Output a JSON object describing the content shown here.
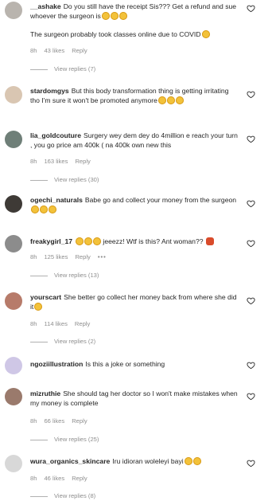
{
  "comments": [
    {
      "username": "__ashake",
      "text": "Do you still have the receipt Sis??? Get a refund and sue whoever the surgeon is",
      "emojis": [
        "grinning-sweat",
        "grinning-sweat",
        "grinning-sweat"
      ],
      "extra_text": "The surgeon probably took classes online due to COVID",
      "extra_emojis": [
        "grinning-sweat"
      ],
      "time": "8h",
      "likes": "43 likes",
      "reply": "Reply",
      "view_replies": "View replies (7)",
      "avatar_color": "#b9b4ae"
    },
    {
      "username": "stardomgys",
      "text": "But this body transformation thing is getting irritating tho I'm sure it won't be promoted anymore",
      "emojis": [
        "sad-face",
        "sad-face",
        "sad-face"
      ],
      "avatar_color": "#d9c6b2"
    },
    {
      "username": "lia_goldcouture",
      "text": "Surgery wey dem dey do 4million e reach your turn , you go price am 400k ( na 400k own new this",
      "time": "8h",
      "likes": "163 likes",
      "reply": "Reply",
      "view_replies": "View replies (30)",
      "avatar_color": "#6f7f78"
    },
    {
      "username": "ogechi_naturals",
      "text": "Babe go and collect your money from the surgeon",
      "emojis": [
        "sad-face",
        "sad-face",
        "sad-face"
      ],
      "avatar_color": "#3e3a36"
    },
    {
      "username": "freakygirl_17",
      "text": "",
      "emojis": [
        "grinning-sweat",
        "grinning-sweat",
        "grinning-sweat"
      ],
      "after_text": "jeeezz! Wtf is this? Ant woman??",
      "after_emojis": [
        "ant"
      ],
      "time": "8h",
      "likes": "125 likes",
      "reply": "Reply",
      "more": "•••",
      "view_replies": "View replies (13)",
      "avatar_color": "#8c8c8c"
    },
    {
      "username": "yourscart",
      "text": "She better go collect her money back from where she did it",
      "emojis": [
        "sad-face"
      ],
      "time": "8h",
      "likes": "114 likes",
      "reply": "Reply",
      "view_replies": "View replies (2)",
      "avatar_color": "#b77b6a"
    },
    {
      "username": "ngoziillustration",
      "text": "Is this a joke or something",
      "avatar_color": "#cfc7e6"
    },
    {
      "username": "mizruthie",
      "text": "She should tag her doctor so I won't make mistakes when my money is complete",
      "time": "8h",
      "likes": "66 likes",
      "reply": "Reply",
      "view_replies": "View replies (25)",
      "avatar_color": "#9a7a6c"
    },
    {
      "username": "wura_organics_skincare",
      "text": "Iru idioran woleleyi bayi",
      "emojis": [
        "sad-face",
        "grinning-sweat"
      ],
      "time": "8h",
      "likes": "46 likes",
      "reply": "Reply",
      "view_replies": "View replies (8)",
      "avatar_color": "#d8d8d8"
    }
  ],
  "icons": {
    "like": "heart-outline-icon"
  }
}
